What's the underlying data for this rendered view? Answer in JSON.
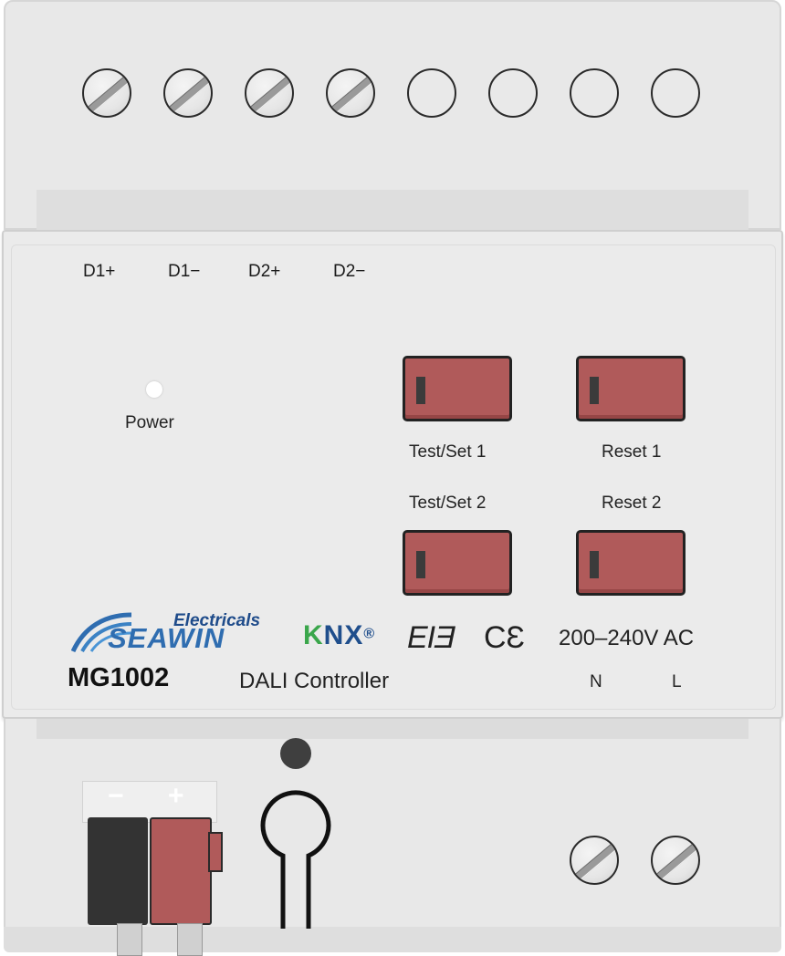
{
  "device": {
    "terminals_top": [
      "D1+",
      "D1−",
      "D2+",
      "D2−"
    ],
    "power_label": "Power",
    "buttons": {
      "test_set_1": "Test/Set 1",
      "reset_1": "Reset 1",
      "test_set_2": "Test/Set 2",
      "reset_2": "Reset 2"
    },
    "brand": {
      "sub": "Electricals",
      "name": "SEAWIN"
    },
    "knx": {
      "k": "K",
      "n": "N",
      "x": "X",
      "reg": "®"
    },
    "certs": {
      "eac": "EIƎ",
      "ce": "CƐ"
    },
    "voltage": "200–240V AC",
    "model": "MG1002",
    "product": "DALI Controller",
    "power_terminals": [
      "N",
      "L"
    ],
    "bus_terminal": {
      "minus": "−",
      "plus": "+"
    },
    "colors": {
      "button_red": "#b05a5a",
      "knx_green": "#3aa64b",
      "knx_blue": "#1f4e8c",
      "brand_blue": "#2f6db0",
      "housing": "#ebebeb"
    }
  }
}
